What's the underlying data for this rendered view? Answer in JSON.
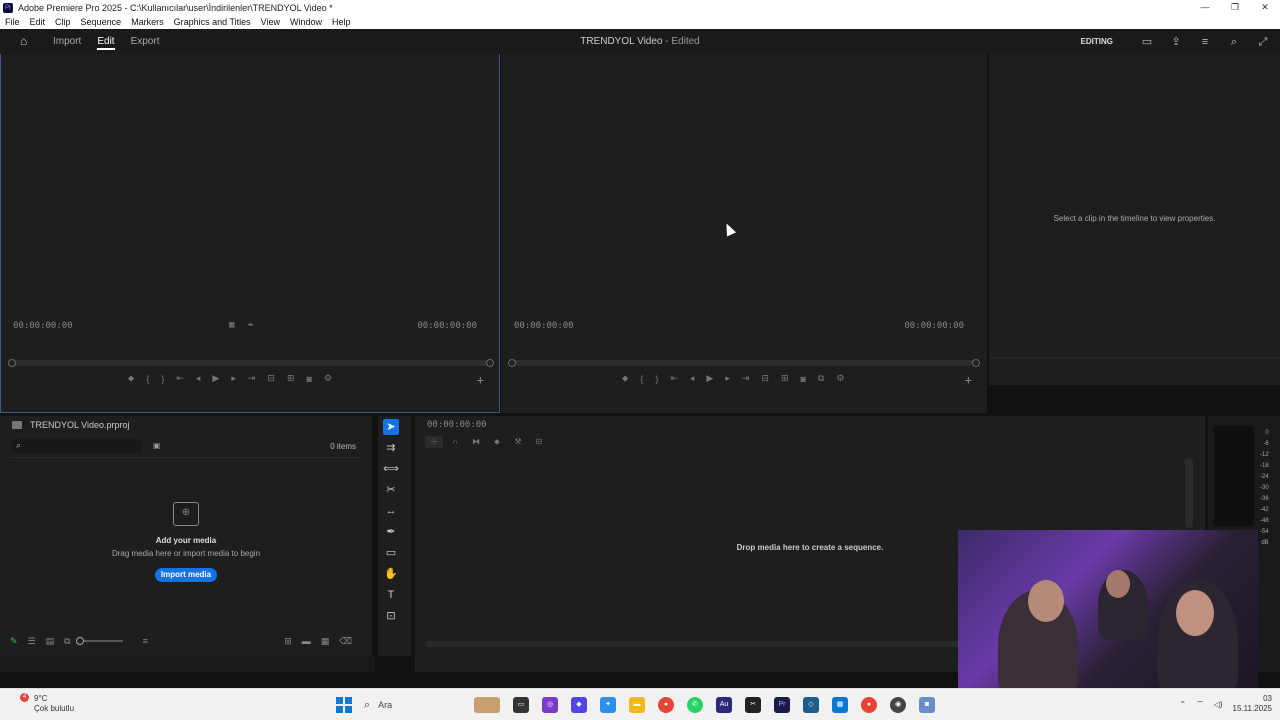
{
  "window": {
    "title": "Adobe Premiere Pro 2025 - C:\\Kullanıcılar\\user\\İndirilenler\\TRENDYOL Video *",
    "controls": [
      "—",
      "❐",
      "✕"
    ]
  },
  "menu": [
    "File",
    "Edit",
    "Clip",
    "Sequence",
    "Markers",
    "Graphics and Titles",
    "View",
    "Window",
    "Help"
  ],
  "header": {
    "tabs": [
      {
        "label": "Import",
        "active": false
      },
      {
        "label": "Edit",
        "active": true
      },
      {
        "label": "Export",
        "active": false
      }
    ],
    "doc_name": "TRENDYOL Video",
    "doc_status": " - Edited",
    "workspace": "EDITING",
    "right_icons": [
      "panel-icon",
      "share-icon",
      "menu-icon",
      "search-icon",
      "fullscreen-icon"
    ]
  },
  "source_monitor": {
    "tc_left": "00:00:00:00",
    "tc_right": "00:00:00:00"
  },
  "program_monitor": {
    "tc_left": "00:00:00:00",
    "tc_right": "00:00:00:00"
  },
  "properties": {
    "message": "Select a clip in the timeline to view properties."
  },
  "project": {
    "name": "TRENDYOL Video.prproj",
    "item_count": "0 items",
    "empty_title": "Add your media",
    "empty_sub": "Drag media here or import media to begin",
    "import_label": "Import media"
  },
  "timeline": {
    "timecode": "00:00:00:00",
    "drop_message": "Drop media here to create a sequence."
  },
  "meters": {
    "scale": [
      "0",
      "-6",
      "-12",
      "-18",
      "-24",
      "-30",
      "-36",
      "-42",
      "-48",
      "-54",
      "dB"
    ]
  },
  "taskbar": {
    "weather_temp": "9°C",
    "weather_desc": "Çok bulutlu",
    "weather_badge": "4",
    "search_label": "Ara",
    "date": "15.11.2025",
    "time": "03"
  }
}
